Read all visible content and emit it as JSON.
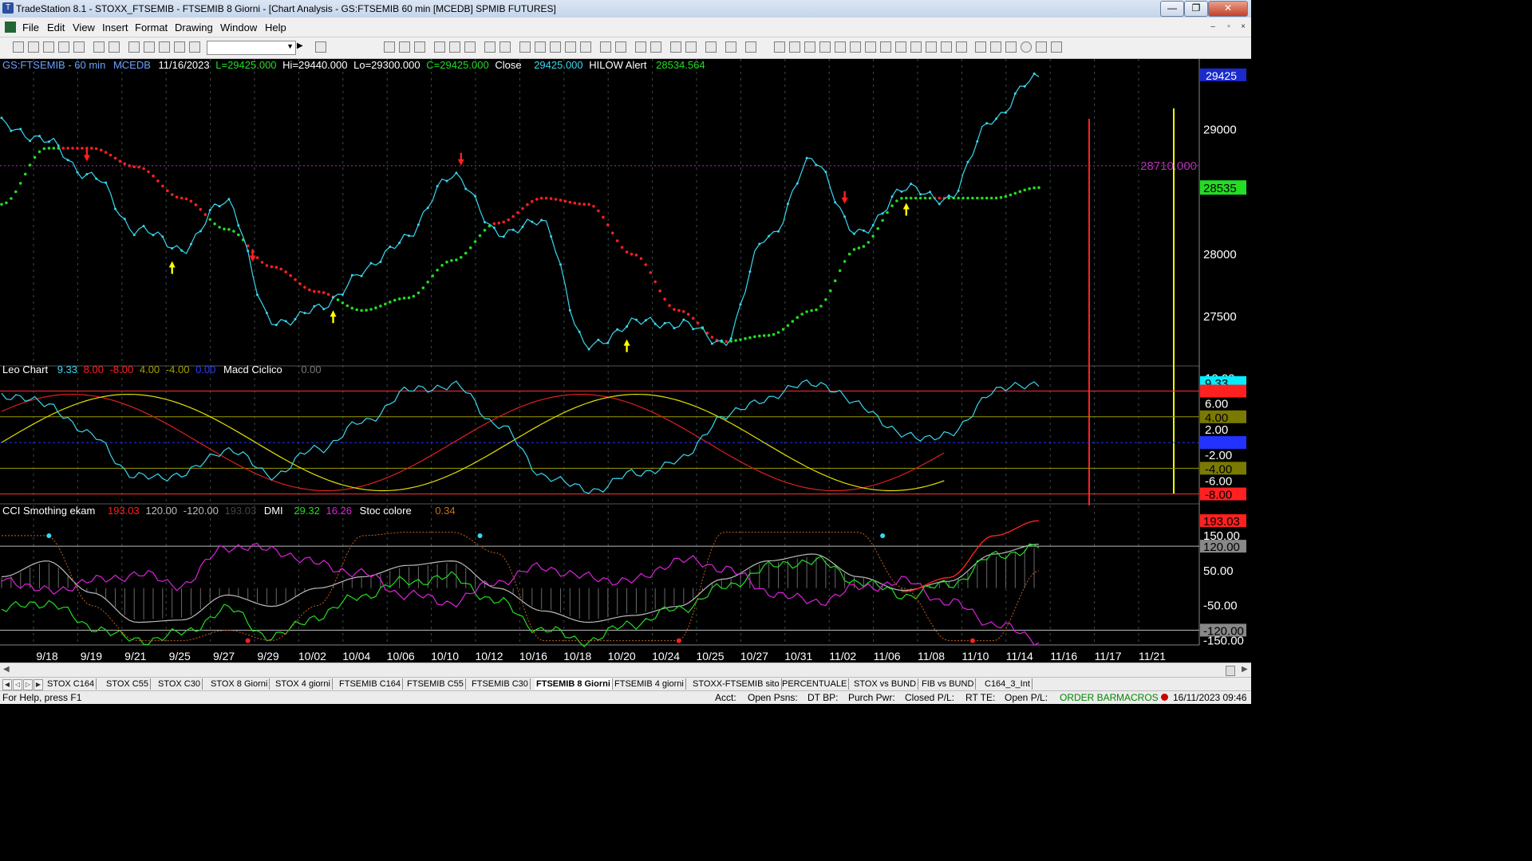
{
  "window": {
    "title": "TradeStation 8.1 - STOXX_FTSEMIB - FTSEMIB  8 Giorni - [Chart Analysis - GS:FTSEMIB  60 min  [MCEDB] SPMIB FUTURES]",
    "minimize": "—",
    "restore": "❐",
    "close": "✕"
  },
  "menu": [
    "File",
    "Edit",
    "View",
    "Insert",
    "Format",
    "Drawing",
    "Window",
    "Help"
  ],
  "mdi": {
    "minimize": "–",
    "restore": "▫",
    "close": "×"
  },
  "price_header": {
    "symbol": "GS:FTSEMIB - 60 min",
    "data": "MCEDB",
    "date": "11/16/2023",
    "last": "L=29425.000",
    "high": "Hi=29440.000",
    "low": "Lo=29300.000",
    "close_val": "C=29425.000",
    "close_label": "Close",
    "close_num": "29425.000",
    "hilow_label": "HILOW Alert",
    "hilow_num": "28534.564"
  },
  "leo_header": {
    "name": "Leo Chart",
    "v1": "9.33",
    "v2": "8.00",
    "v3": "-8.00",
    "v4": "4.00",
    "v5": "-4.00",
    "v6": "0.00",
    "macd_label": "Macd Ciclico",
    "macd_val": "0.00"
  },
  "cci_header": {
    "name": "CCI Smothing ekam",
    "v1": "193.03",
    "v2": "120.00",
    "v3": "-120.00",
    "v4": "193.03",
    "dmi_label": "DMI",
    "dmi1": "29.32",
    "dmi2": "16.26",
    "stoc_label": "Stoc colore",
    "stoc_val": "0.34"
  },
  "price_axis": [
    "29425",
    "29000",
    "28710.000",
    "28535",
    "28000",
    "27500"
  ],
  "leo_axis": [
    "10.00",
    "9.33",
    "8.00",
    "6.00",
    "4.00",
    "2.00",
    "0.00",
    "-2.00",
    "-4.00",
    "-6.00",
    "-8.00"
  ],
  "cci_axis": [
    "193.03",
    "150.00",
    "120.00",
    "50.00",
    "-50.00",
    "-120.00",
    "-150.00"
  ],
  "date_labels": [
    "9/18",
    "9/19",
    "9/21",
    "9/25",
    "9/27",
    "9/29",
    "10/02",
    "10/04",
    "10/06",
    "10/10",
    "10/12",
    "10/16",
    "10/18",
    "10/20",
    "10/24",
    "10/25",
    "10/27",
    "10/31",
    "11/02",
    "11/06",
    "11/08",
    "11/10",
    "11/14",
    "11/16",
    "11/17",
    "11/21"
  ],
  "tabs": [
    "STOX C164",
    "STOX C55",
    "STOX  C30",
    "STOX  8 Giorni",
    "STOX 4 giorni",
    "FTSEMIB C164",
    "FTSEMIB C55",
    "FTSEMIB C30",
    "FTSEMIB  8 Giorni",
    "FTSEMIB  4 giorni",
    "STOXX-FTSEMIB sito",
    "PERCENTUALE",
    "STOX vs BUND",
    "FIB vs BUND",
    "C164_3_Int"
  ],
  "status": {
    "help": "For Help, press F1",
    "acct": "Acct:",
    "open_psns": "Open Psns:",
    "dt_bp": "DT BP:",
    "purch_pwr": "Purch Pwr:",
    "closed_pl": "Closed P/L:",
    "rt_te": "RT TE:",
    "open_pl": "Open P/L:",
    "order_bar": "ORDER BAR",
    "macros": "MACROS",
    "datetime": "16/11/2023 09:46"
  },
  "colors": {
    "price": "#38d8f0",
    "up_trend": "#22dd22",
    "down_trend": "#ff2020",
    "arrow_up": "#ffff00",
    "arrow_down": "#ff2020",
    "background": "#000000"
  },
  "chart_data": [
    {
      "type": "line",
      "title": "GS:FTSEMIB - 60 min",
      "ylim": [
        27150,
        29450
      ],
      "x": [
        "9/18",
        "9/19",
        "9/21",
        "9/25",
        "9/27",
        "9/29",
        "10/02",
        "10/04",
        "10/06",
        "10/10",
        "10/12",
        "10/16",
        "10/18",
        "10/20",
        "10/24",
        "10/25",
        "10/27",
        "10/31",
        "11/02",
        "11/06",
        "11/08",
        "11/10",
        "11/14",
        "11/16"
      ],
      "series": [
        {
          "name": "Close",
          "values": [
            29050,
            28900,
            28620,
            28200,
            28050,
            28430,
            27450,
            27550,
            27850,
            28150,
            28650,
            28180,
            28250,
            27250,
            27450,
            27450,
            27300,
            28150,
            28750,
            28150,
            28520,
            28450,
            29100,
            29425
          ]
        },
        {
          "name": "HILOW Alert",
          "values": [
            28400,
            28850,
            28850,
            28700,
            28450,
            28200,
            27900,
            27700,
            27550,
            27650,
            27950,
            28250,
            28450,
            28400,
            28000,
            27550,
            27300,
            27350,
            27550,
            28050,
            28450,
            28450,
            28450,
            28534.564
          ]
        }
      ]
    },
    {
      "type": "line",
      "title": "Leo Chart",
      "ylim": [
        -8,
        10
      ],
      "series": [
        {
          "name": "Leo Chart",
          "values": [
            7.5,
            6.0,
            1.0,
            -5.5,
            -5.0,
            -1.0,
            -5.0,
            -1.0,
            3.0,
            8.0,
            9.0,
            3.0,
            -5.0,
            -7.5,
            -5.0,
            -3.0,
            4.0,
            7.0,
            9.5,
            6.0,
            1.0,
            1.0,
            8.0,
            9.33
          ]
        }
      ]
    },
    {
      "type": "line",
      "title": "CCI Smothing ekam",
      "ylim": [
        -150,
        193.03
      ],
      "series": [
        {
          "name": "CCI Smothing ekam",
          "values": [
            50,
            120,
            -20,
            -150,
            -140,
            -30,
            -80,
            0,
            50,
            100,
            120,
            0,
            -100,
            -150,
            -120,
            -80,
            40,
            120,
            150,
            50,
            -10,
            30,
            150,
            193.03
          ]
        }
      ]
    }
  ]
}
